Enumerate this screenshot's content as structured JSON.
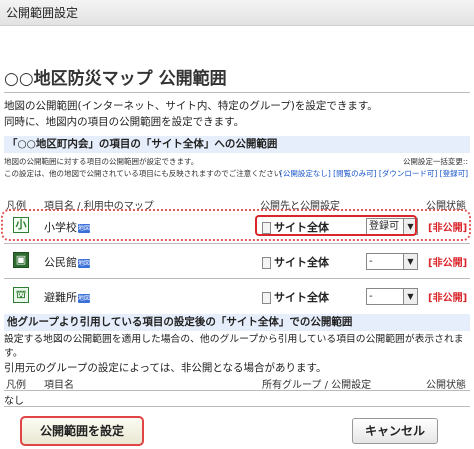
{
  "window": {
    "title": "公開範囲設定"
  },
  "page": {
    "title": "○○地区防災マップ 公開範囲",
    "description": [
      "地図の公開範囲(インターネット、サイト内、特定のグループ)を設定できます。",
      "同時に、地図内の項目の公開範囲を設定できます。"
    ]
  },
  "section1": {
    "heading": "「○○地区町内会」の項目の「サイト全体」への公開範囲",
    "note_line1": "地図の公開範囲に対する項目の公開範囲が設定できます。",
    "note_line2": "この設定は、他の地図で公開されている項目にも反映されますのでご注意ください",
    "bulk_label": "公開設定一括変更::",
    "links": [
      "[公開設定なし]",
      "[閲覧のみ可]",
      "[ダウンロード可]",
      "[登録可]"
    ],
    "columns": [
      "凡例",
      "項目名 / 利用中のマップ",
      "公開先と公開設定",
      "公開状態"
    ],
    "rows": [
      {
        "icon": "小",
        "name": "小学校",
        "badge": "地図",
        "scope": "サイト全体",
        "setting": "登録可",
        "status": "[非公開]",
        "icon_style": "outline"
      },
      {
        "icon": "▣",
        "name": "公民館",
        "badge": "地図",
        "scope": "サイト全体",
        "setting": "-",
        "status": "[非公開]",
        "icon_style": "dark"
      },
      {
        "icon": "⛫",
        "name": "避難所",
        "badge": "地図",
        "scope": "サイト全体",
        "setting": "-",
        "status": "[非公開]",
        "icon_style": "light"
      }
    ]
  },
  "section2": {
    "heading": "他グループより引用している項目の設定後の「サイト全体」での公開範囲",
    "description": [
      "設定する地図の公開範囲を適用した場合の、他のグループから引用している項目の公開範囲が表示されます。",
      "引用元のグループの設定によっては、非公開となる場合があります。"
    ],
    "columns": [
      "凡例",
      "項目名",
      "所有グループ / 公開設定",
      "公開状態"
    ],
    "empty_text": "なし"
  },
  "buttons": {
    "submit": "公開範囲を設定",
    "cancel": "キャンセル"
  },
  "colors": {
    "accent_red": "#d9262b",
    "section_bg": "#e6eefb",
    "link": "#1a56c8"
  }
}
